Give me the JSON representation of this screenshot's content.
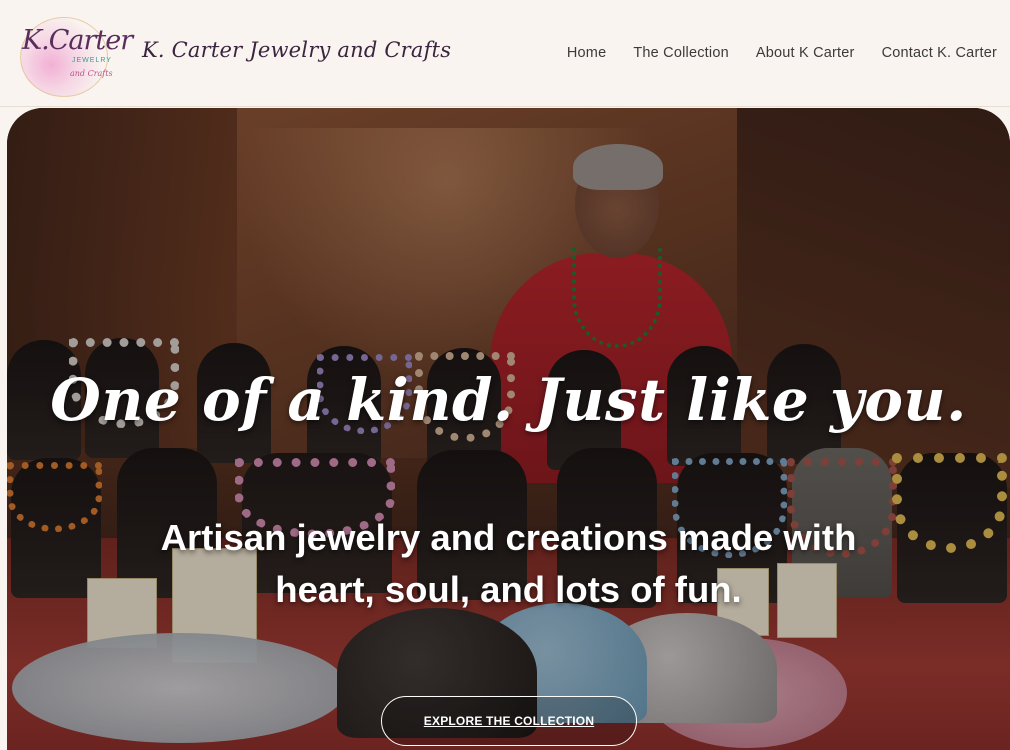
{
  "header": {
    "logo": {
      "line1": "K.Carter",
      "line2": "JEWELRY",
      "line3": "and Crafts"
    },
    "brand": "K. Carter Jewelry and Crafts",
    "nav": [
      "Home",
      "The Collection",
      "About K Carter",
      "Contact K. Carter"
    ]
  },
  "hero": {
    "tagline": "One of a kind. Just like you.",
    "subtitle": "Artisan jewelry and creations made with heart, soul, and lots of fun.",
    "cta": "EXPLORE THE COLLECTION"
  },
  "colors": {
    "background": "#f9f4ef",
    "text_dark": "#3a2540",
    "hero_text": "#ffffff"
  }
}
